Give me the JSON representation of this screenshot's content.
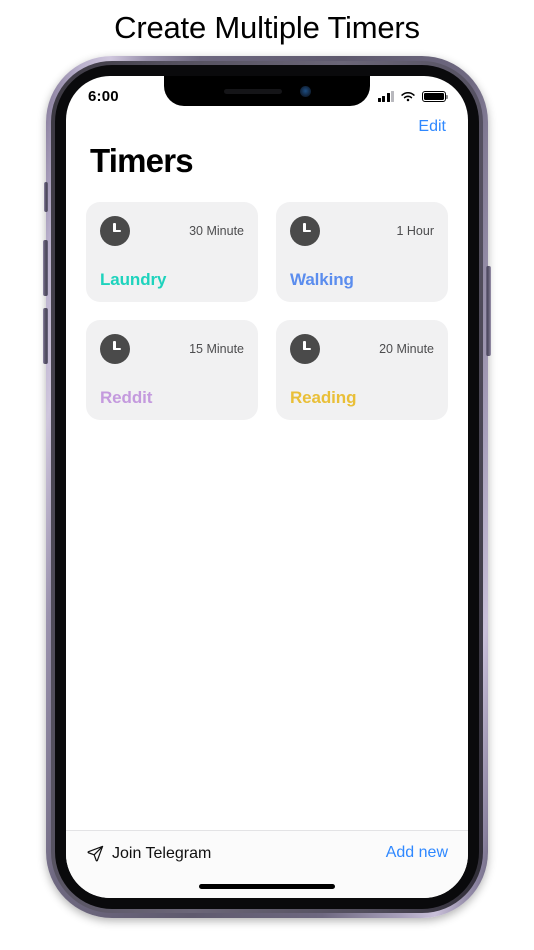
{
  "heading": "Create Multiple Timers",
  "phone": {
    "status_bar": {
      "time": "6:00",
      "cellular_icon": "cellular-signal-icon",
      "wifi_icon": "wifi-icon",
      "battery_icon": "battery-full-icon"
    },
    "buttons": {
      "mute_switch": "mute-switch",
      "volume_up": "volume-up-button",
      "volume_down": "volume-down-button",
      "power": "power-button"
    }
  },
  "app": {
    "nav": {
      "edit_label": "Edit"
    },
    "title": "Timers",
    "timers": [
      {
        "icon": "clock-icon",
        "duration": "30 Minute",
        "name": "Laundry",
        "color": "#1ed3bd"
      },
      {
        "icon": "clock-icon",
        "duration": "1 Hour",
        "name": "Walking",
        "color": "#5b8dee"
      },
      {
        "icon": "clock-icon",
        "duration": "15 Minute",
        "name": "Reddit",
        "color": "#c49ade"
      },
      {
        "icon": "clock-icon",
        "duration": "20 Minute",
        "name": "Reading",
        "color": "#e9bf38"
      }
    ],
    "bottom_bar": {
      "telegram_icon": "send-icon",
      "telegram_label": "Join Telegram",
      "add_new_label": "Add new"
    }
  },
  "colors": {
    "accent_blue": "#2f88ff",
    "card_bg": "#f1f1f2",
    "clock_bg": "#4a4a4a"
  }
}
